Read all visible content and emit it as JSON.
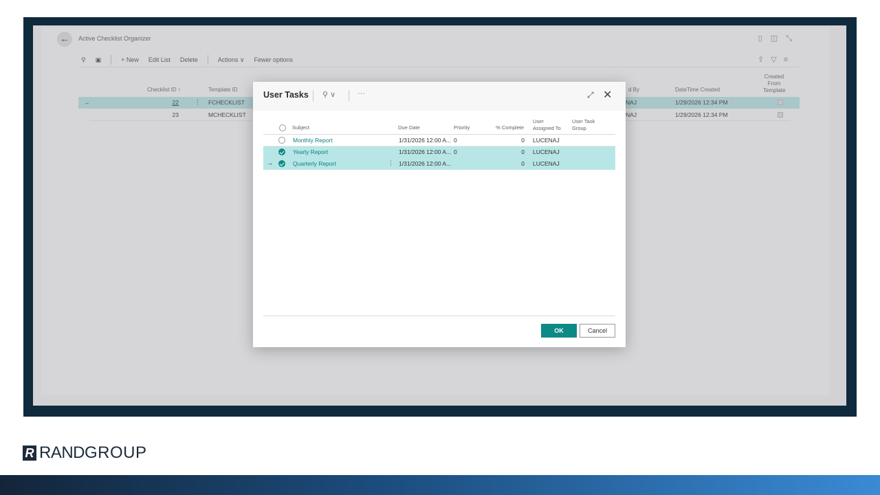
{
  "background_page": {
    "title": "Active Checklist Organizer",
    "toolbar": {
      "new_label": "+ New",
      "edit_list_label": "Edit List",
      "delete_label": "Delete",
      "actions_label": "Actions ∨",
      "fewer_options_label": "Fewer options"
    },
    "columns": {
      "checklist_id": "Checklist ID ↑",
      "template_id": "Template ID",
      "created_by": "d By",
      "datetime_created": "DateTime Created",
      "created_from_template": "Created From Template"
    },
    "rows": [
      {
        "arrow": "→",
        "checklist_id": "22",
        "template_id": "FCHECKLIST",
        "created_by": "NAJ",
        "datetime_created": "1/29/2026 12:34 PM"
      },
      {
        "arrow": "",
        "checklist_id": "23",
        "template_id": "MCHECKLIST",
        "created_by": "NAJ",
        "datetime_created": "1/29/2026 12:34 PM"
      }
    ]
  },
  "dialog": {
    "title": "User Tasks",
    "more_label": "···",
    "columns": {
      "subject": "Subject",
      "due_date": "Due Date",
      "priority": "Priority",
      "pct_complete": "% Complete",
      "user_assigned_to": "User Assigned To",
      "user_task_group": "User Task Group"
    },
    "rows": [
      {
        "arrow": "",
        "subject": "Monthly Report",
        "due_date": "1/31/2026 12:00 A...",
        "priority": "0",
        "pct": "0",
        "user": "LUCENAJ"
      },
      {
        "arrow": "",
        "subject": "Yearly Report",
        "due_date": "1/31/2026 12:00 A...",
        "priority": "0",
        "pct": "0",
        "user": "LUCENAJ"
      },
      {
        "arrow": "→",
        "subject": "Quarterly Report",
        "due_date": "1/31/2026 12:00 A...",
        "priority": "",
        "pct": "0",
        "user": "LUCENAJ"
      }
    ],
    "ok_label": "OK",
    "cancel_label": "Cancel"
  },
  "branding": {
    "logo_mark": "R",
    "logo_rand": "RAND",
    "logo_group": "GROUP"
  }
}
